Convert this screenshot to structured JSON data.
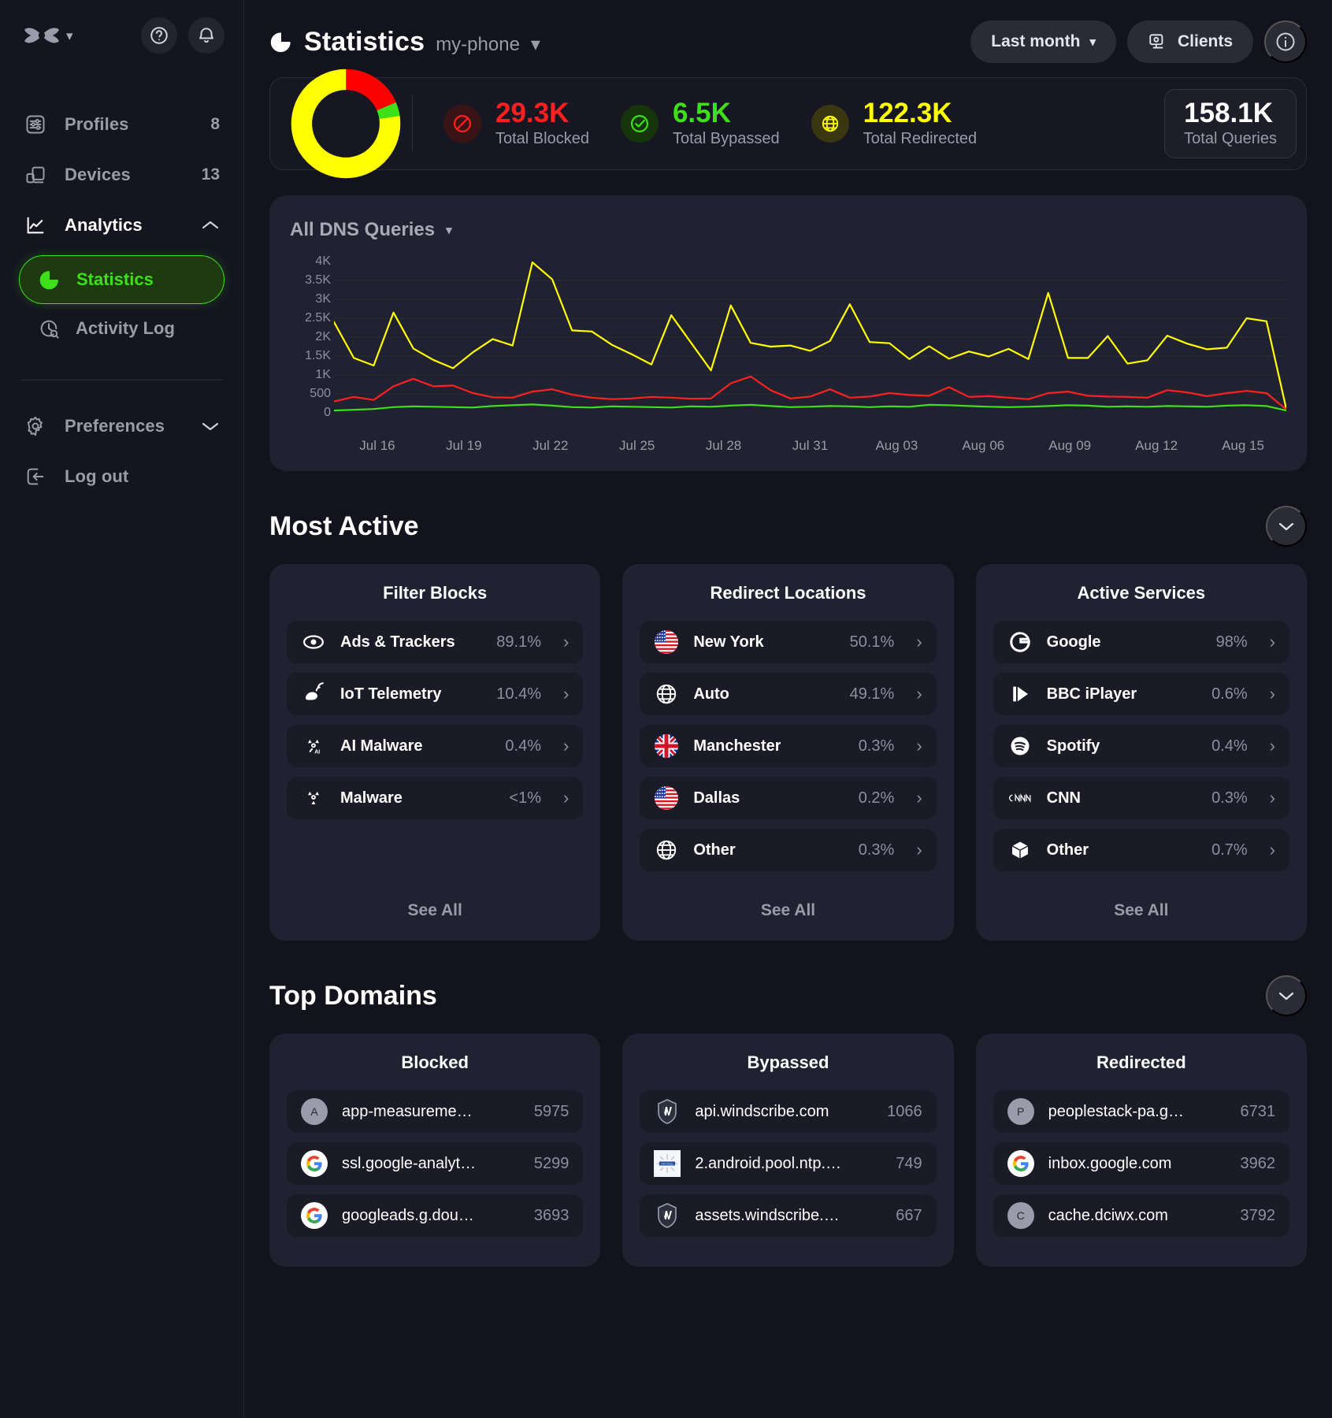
{
  "sidebar": {
    "logo_icon": "windscribe-logo-icon",
    "logo_caret_icon": "chevron-down-icon",
    "help_icon": "help-circle-icon",
    "bell_icon": "bell-icon",
    "items": [
      {
        "label": "Profiles",
        "count": "8",
        "icon": "sliders-icon"
      },
      {
        "label": "Devices",
        "count": "13",
        "icon": "devices-icon"
      },
      {
        "label": "Analytics",
        "count": "",
        "icon": "chart-line-icon",
        "caret": "chevron-up-icon"
      }
    ],
    "sub_items": [
      {
        "label": "Statistics",
        "icon": "pie-chart-icon",
        "selected": true
      },
      {
        "label": "Activity Log",
        "icon": "history-search-icon",
        "selected": false
      }
    ],
    "footer_items": [
      {
        "label": "Preferences",
        "icon": "gear-icon",
        "caret": "chevron-down-icon"
      },
      {
        "label": "Log out",
        "icon": "logout-icon",
        "caret": ""
      }
    ]
  },
  "header": {
    "icon": "pie-chart-icon",
    "title": "Statistics",
    "profile": "my-phone",
    "profile_caret": "chevron-down-icon",
    "range_label": "Last month",
    "range_caret": "caret-down-icon",
    "clients_label": "Clients",
    "clients_icon": "monitor-icon",
    "info_icon": "info-circle-icon"
  },
  "summary": {
    "donut": {
      "segments": [
        {
          "name": "Blocked",
          "percent": 18.5,
          "color": "#ff0000"
        },
        {
          "name": "Bypassed",
          "percent": 4.1,
          "color": "#3ee01a"
        },
        {
          "name": "Redirected",
          "percent": 77.4,
          "color": "#ffff00"
        }
      ]
    },
    "stats": [
      {
        "value": "29.3K",
        "label": "Total Blocked",
        "color": "#ff1f1f",
        "icon": "blocked-icon",
        "bg": "#3a1414"
      },
      {
        "value": "6.5K",
        "label": "Total Bypassed",
        "color": "#3ee01a",
        "icon": "check-circle-icon",
        "bg": "#15350c"
      },
      {
        "value": "122.3K",
        "label": "Total Redirected",
        "color": "#ffff00",
        "icon": "globe-icon",
        "bg": "#3a3610"
      }
    ],
    "total": {
      "value": "158.1K",
      "label": "Total Queries"
    }
  },
  "chart_data": {
    "type": "line",
    "title": "All DNS Queries",
    "dropdown_icon": "caret-down-icon",
    "xlabel": "",
    "ylabel": "",
    "ylim": [
      0,
      4000
    ],
    "yticks": [
      "0",
      "500",
      "1K",
      "1.5K",
      "2K",
      "2.5K",
      "3K",
      "3.5K",
      "4K"
    ],
    "ytick_values": [
      0,
      500,
      1000,
      1500,
      2000,
      2500,
      3000,
      3500,
      4000
    ],
    "xticks": [
      "Jul 16",
      "Jul 19",
      "Jul 22",
      "Jul 25",
      "Jul 28",
      "Jul 31",
      "Aug 03",
      "Aug 06",
      "Aug 09",
      "Aug 12",
      "Aug 15"
    ],
    "grid": true,
    "legend": "none",
    "series": [
      {
        "name": "Redirected",
        "color": "#ffff00",
        "values": [
          2400,
          1450,
          1250,
          2650,
          1700,
          1400,
          1180,
          1600,
          1950,
          1780,
          3980,
          3530,
          2180,
          2150,
          1800,
          1550,
          1280,
          2580,
          1850,
          1120,
          2840,
          1850,
          1750,
          1780,
          1640,
          1900,
          2870,
          1870,
          1840,
          1420,
          1760,
          1430,
          1620,
          1490,
          1690,
          1420,
          3170,
          1450,
          1450,
          2030,
          1300,
          1390,
          2040,
          1830,
          1680,
          1720,
          2500,
          2420,
          100
        ]
      },
      {
        "name": "Blocked",
        "color": "#ff2020",
        "values": [
          300,
          420,
          340,
          700,
          900,
          700,
          720,
          520,
          410,
          400,
          560,
          620,
          480,
          400,
          360,
          380,
          420,
          400,
          370,
          380,
          780,
          960,
          600,
          380,
          430,
          620,
          400,
          430,
          520,
          470,
          450,
          680,
          420,
          440,
          400,
          360,
          520,
          560,
          450,
          430,
          420,
          400,
          600,
          540,
          440,
          520,
          580,
          520,
          90
        ]
      },
      {
        "name": "Bypassed",
        "color": "#3ee01a",
        "values": [
          60,
          80,
          100,
          150,
          170,
          160,
          150,
          140,
          180,
          200,
          220,
          190,
          150,
          140,
          170,
          160,
          150,
          140,
          170,
          160,
          190,
          210,
          180,
          150,
          160,
          180,
          170,
          150,
          170,
          160,
          210,
          200,
          180,
          160,
          150,
          160,
          180,
          200,
          190,
          160,
          170,
          160,
          180,
          170,
          160,
          190,
          200,
          180,
          60
        ]
      }
    ]
  },
  "most_active": {
    "title": "Most Active",
    "toggle_icon": "chevron-down-icon",
    "cards": [
      {
        "title": "Filter Blocks",
        "see_all": "See All",
        "rows": [
          {
            "name": "Ads & Trackers",
            "value": "89.1%",
            "icon": "eye-icon"
          },
          {
            "name": "IoT Telemetry",
            "value": "10.4%",
            "icon": "iot-telemetry-icon"
          },
          {
            "name": "AI Malware",
            "value": "0.4%",
            "icon": "ai-malware-icon"
          },
          {
            "name": "Malware",
            "value": "<1%",
            "icon": "malware-icon"
          }
        ]
      },
      {
        "title": "Redirect Locations",
        "see_all": "See All",
        "rows": [
          {
            "name": "New York",
            "value": "50.1%",
            "icon": "flag-us-icon"
          },
          {
            "name": "Auto",
            "value": "49.1%",
            "icon": "globe-icon"
          },
          {
            "name": "Manchester",
            "value": "0.3%",
            "icon": "flag-uk-icon"
          },
          {
            "name": "Dallas",
            "value": "0.2%",
            "icon": "flag-us-icon"
          },
          {
            "name": "Other",
            "value": "0.3%",
            "icon": "globe-icon"
          }
        ]
      },
      {
        "title": "Active Services",
        "see_all": "See All",
        "rows": [
          {
            "name": "Google",
            "value": "98%",
            "icon": "google-icon"
          },
          {
            "name": "BBC iPlayer",
            "value": "0.6%",
            "icon": "bbc-iplayer-icon"
          },
          {
            "name": "Spotify",
            "value": "0.4%",
            "icon": "spotify-icon"
          },
          {
            "name": "CNN",
            "value": "0.3%",
            "icon": "cnn-icon"
          },
          {
            "name": "Other",
            "value": "0.7%",
            "icon": "box-icon"
          }
        ]
      }
    ]
  },
  "top_domains": {
    "title": "Top Domains",
    "toggle_icon": "chevron-down-icon",
    "cards": [
      {
        "title": "Blocked",
        "rows": [
          {
            "name": "app-measureme…",
            "value": "5975",
            "icon": "letter-avatar-a"
          },
          {
            "name": "ssl.google-analyt…",
            "value": "5299",
            "icon": "google-favicon"
          },
          {
            "name": "googleads.g.dou…",
            "value": "3693",
            "icon": "google-favicon"
          }
        ]
      },
      {
        "title": "Bypassed",
        "rows": [
          {
            "name": "api.windscribe.com",
            "value": "1066",
            "icon": "windscribe-favicon"
          },
          {
            "name": "2.android.pool.ntp.…",
            "value": "749",
            "icon": "ntp-favicon"
          },
          {
            "name": "assets.windscribe.…",
            "value": "667",
            "icon": "windscribe-favicon"
          }
        ]
      },
      {
        "title": "Redirected",
        "rows": [
          {
            "name": "peoplestack-pa.g…",
            "value": "6731",
            "icon": "letter-avatar-p"
          },
          {
            "name": "inbox.google.com",
            "value": "3962",
            "icon": "google-favicon"
          },
          {
            "name": "cache.dciwx.com",
            "value": "3792",
            "icon": "letter-avatar-c"
          }
        ]
      }
    ]
  }
}
